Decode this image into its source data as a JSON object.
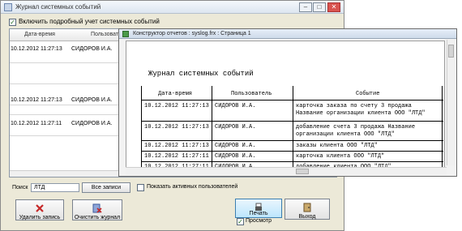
{
  "main_window": {
    "title": "Журнал системных событий"
  },
  "log_checkbox": {
    "checked": true,
    "label": "Включить подробный учет системных событий"
  },
  "grid": {
    "columns": [
      "Дата-время",
      "Пользователь"
    ],
    "rows": [
      [
        "10.12.2012 11:27:13",
        "СИДОРОВ И.А."
      ],
      [
        "10.12.2012 11:27:13",
        "СИДОРОВ И.А."
      ],
      [
        "10.12.2012 11:27:13",
        "СИДОРОВ И.А."
      ],
      [
        "10.12.2012 11:27:11",
        "СИДОРОВ И.А."
      ]
    ]
  },
  "search": {
    "label": "Поиск",
    "value": "ЛТД"
  },
  "buttons": {
    "all_records": "Все записи",
    "delete": "Удалить запись",
    "clear": "Очистить журнал",
    "print": "Печать",
    "exit": "Выход"
  },
  "active_users": {
    "checked": false,
    "label": "Показать активных пользователей"
  },
  "preview": {
    "checked": true,
    "label": "Просмотр"
  },
  "report_window": {
    "title": "Конструктор отчетов  :  syslog.frx  :  Страница 1",
    "heading": "Журнал системных событий",
    "columns": [
      "Дата-время",
      "Пользователь",
      "Событие"
    ],
    "rows": [
      {
        "dt": "10.12.2012 11:27:13",
        "user": "СИДОРОВ И.А.",
        "event": [
          "карточка заказа по счету 3 продажа",
          "Название организации клиента ООО \"ЛТД\""
        ]
      },
      {
        "dt": "10.12.2012 11:27:13",
        "user": "СИДОРОВ И.А.",
        "event": [
          "добавление счета 3 продажа Название",
          "организации клиента ООО \"ЛТД\""
        ]
      },
      {
        "dt": "10.12.2012 11:27:13",
        "user": "СИДОРОВ И.А.",
        "event": [
          "заказы клиента ООО \"ЛТД\""
        ]
      },
      {
        "dt": "10.12.2012 11:27:11",
        "user": "СИДОРОВ И.А.",
        "event": [
          "карточка клиента ООО \"ЛТД\""
        ]
      },
      {
        "dt": "10.12.2012 11:27:11",
        "user": "СИДОРОВ И.А.",
        "event": [
          "добавление клиента ООО \"ЛТД\""
        ]
      }
    ]
  },
  "colors": {
    "window_bg": "#ece9d8",
    "print_button": "#bde6fd",
    "close_button": "#d9534f"
  }
}
